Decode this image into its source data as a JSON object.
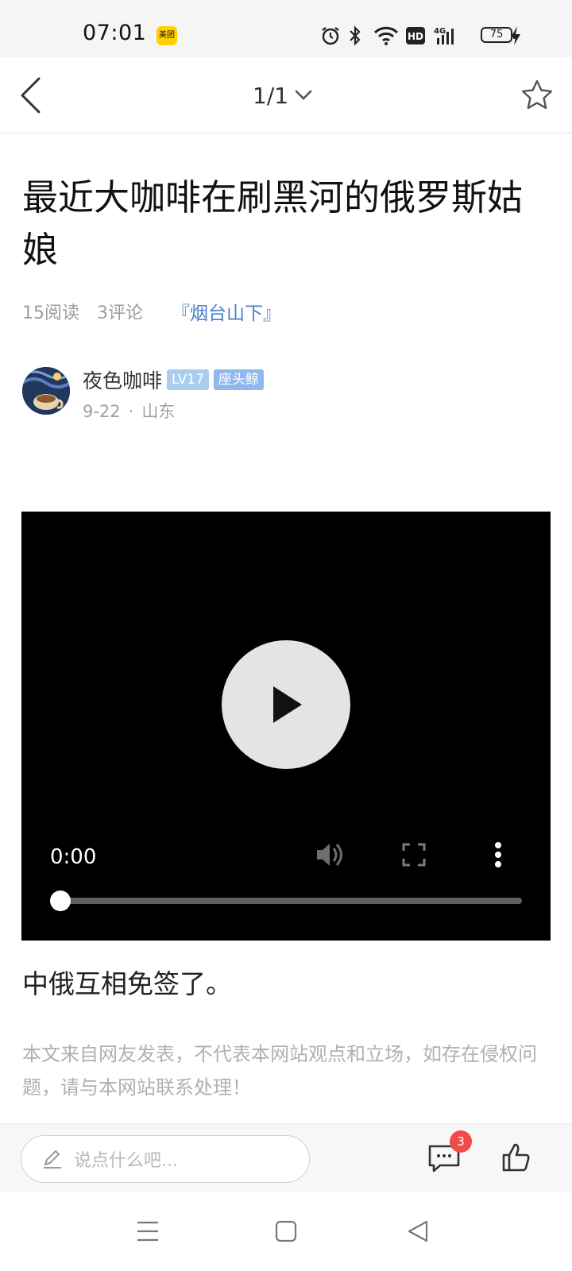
{
  "status_bar": {
    "time": "07:01",
    "app_badge": "美团",
    "battery": "75",
    "icons": [
      "alarm-icon",
      "bluetooth-icon",
      "wifi-icon",
      "hd-icon",
      "4g-signal-icon",
      "battery-icon",
      "charging-icon"
    ]
  },
  "header": {
    "page_indicator": "1/1",
    "icons": [
      "back-arrow-icon",
      "chevron-down-icon",
      "star-icon"
    ]
  },
  "article": {
    "title": "最近大咖啡在刷黑河的俄罗斯姑娘",
    "reads": "15阅读",
    "comments": "3评论",
    "topic": "『烟台山下』",
    "author": {
      "name": "夜色咖啡",
      "level": "LV17",
      "title_badge": "座头鲸",
      "date": "9-22",
      "separator": "·",
      "location": "山东"
    },
    "video": {
      "current_time": "0:00",
      "progress": 0
    },
    "body": "中俄互相免签了。",
    "disclaimer": "本文来自网友发表，不代表本网站观点和立场，如存在侵权问题，请与本网站联系处理！"
  },
  "bottom_bar": {
    "comment_placeholder": "说点什么吧...",
    "comment_count": "3"
  },
  "colors": {
    "topic_link": "#4a7fc1",
    "badge_level": "#a9cdef",
    "badge_title": "#8fb8ee",
    "comment_count_badge": "#f24a4a",
    "video_bg": "#000000"
  }
}
